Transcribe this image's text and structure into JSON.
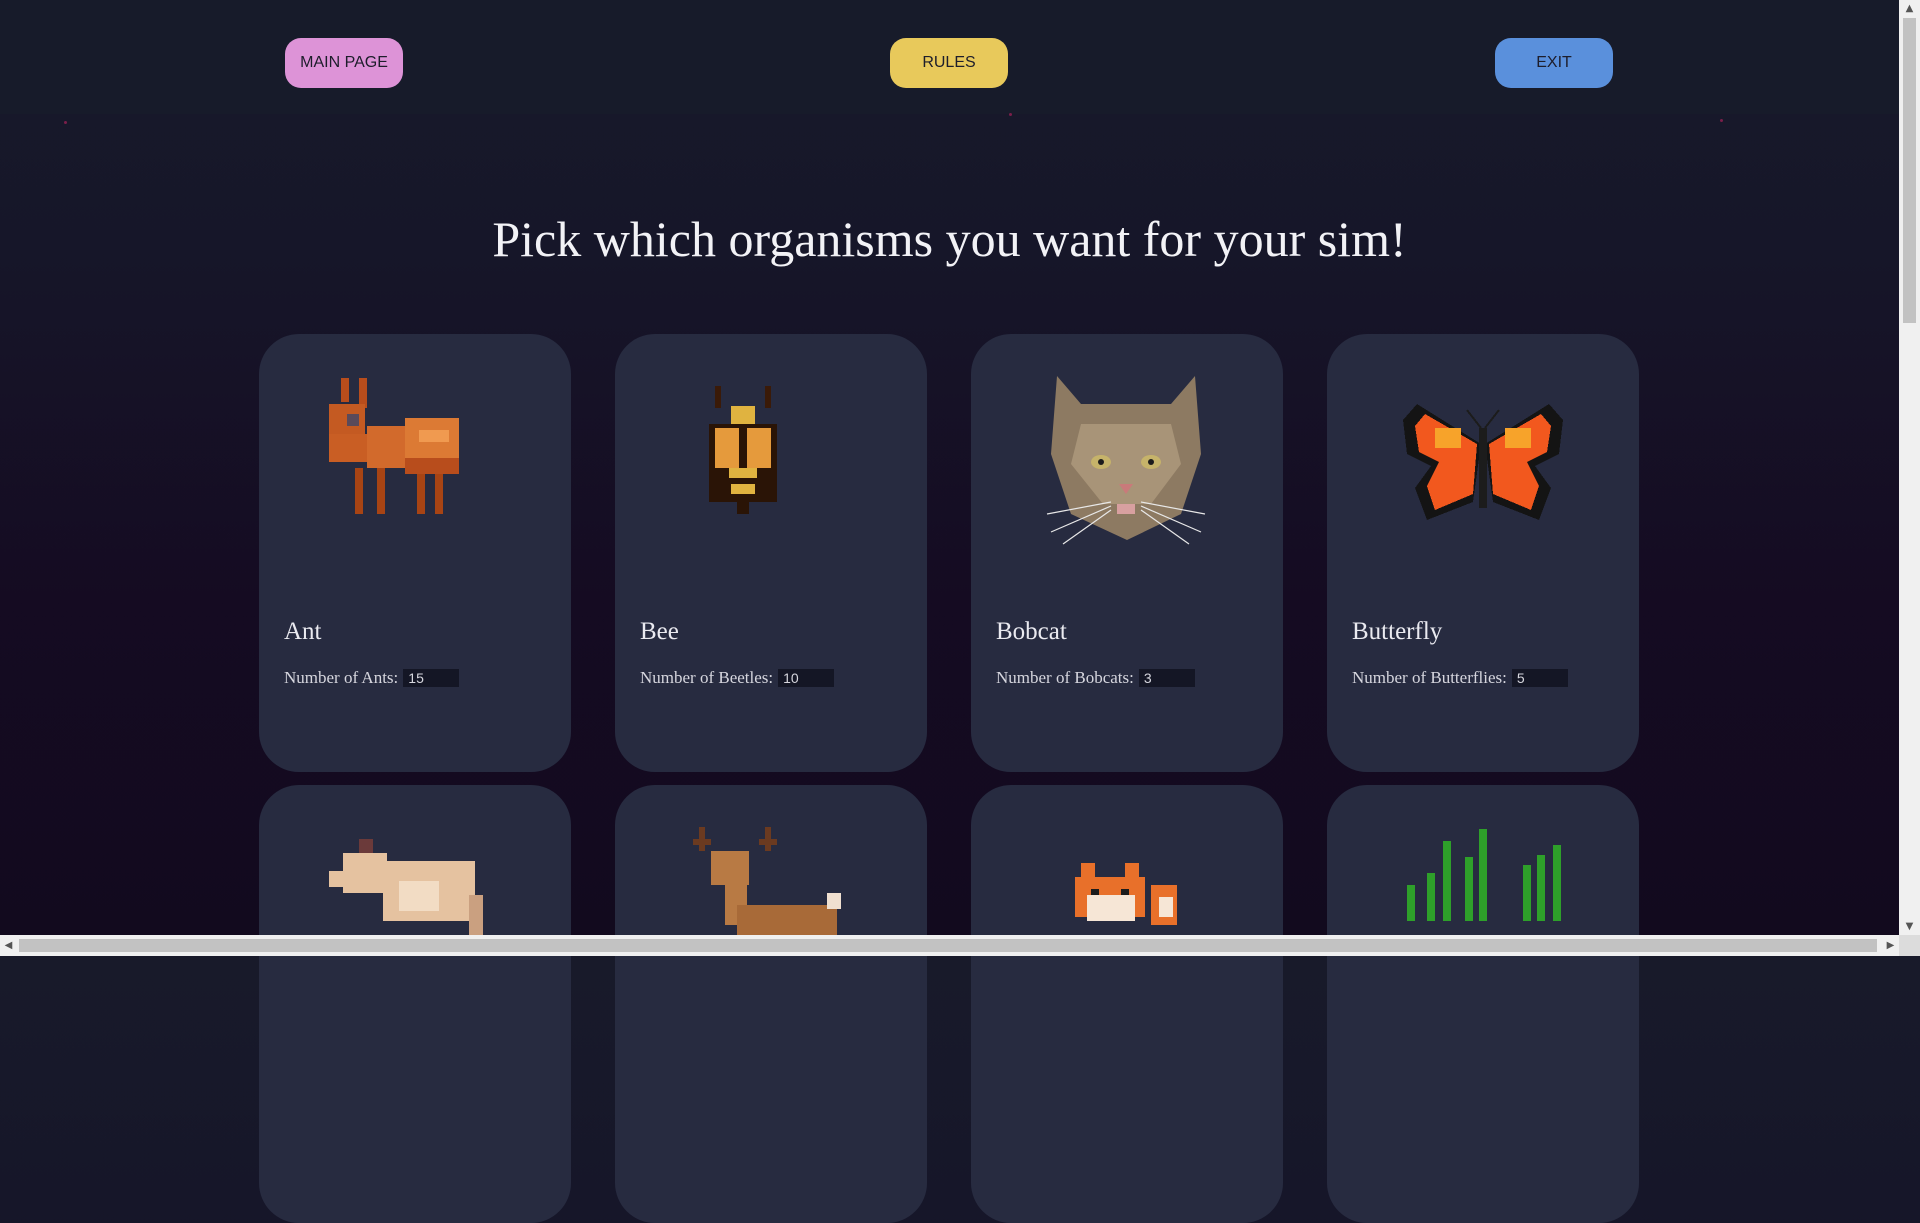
{
  "nav": {
    "main_label": "MAIN PAGE",
    "rules_label": "RULES",
    "exit_label": "EXIT"
  },
  "heading": "Pick which organisms you want for your sim!",
  "cards": [
    {
      "name": "Ant",
      "field_label": "Number of Ants:",
      "value": "15",
      "icon": "ant-icon"
    },
    {
      "name": "Bee",
      "field_label": "Number of Beetles:",
      "value": "10",
      "icon": "bee-icon"
    },
    {
      "name": "Bobcat",
      "field_label": "Number of Bobcats:",
      "value": "3",
      "icon": "bobcat-icon"
    },
    {
      "name": "Butterfly",
      "field_label": "Number of Butterflies:",
      "value": "5",
      "icon": "butterfly-icon"
    }
  ],
  "more_cards": [
    {
      "icon": "coyote-icon"
    },
    {
      "icon": "deer-icon"
    },
    {
      "icon": "fox-icon"
    },
    {
      "icon": "grass-icon"
    }
  ],
  "colors": {
    "main_button": "#dd93d7",
    "rules_button": "#e8c95b",
    "exit_button": "#5a90dc",
    "card_bg": "#272b40"
  }
}
